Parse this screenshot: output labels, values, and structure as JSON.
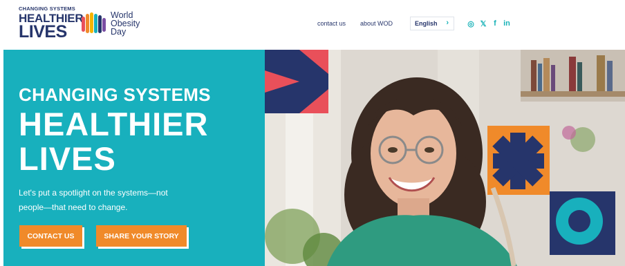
{
  "header": {
    "campaign_logo": {
      "line1": "CHANGING SYSTEMS",
      "line2": "HEALTHIER",
      "line3": "LIVES"
    },
    "wod_logo": {
      "line1": "World",
      "line2": "Obesity",
      "line3": "Day"
    },
    "nav": {
      "contact": "contact us",
      "about": "about WOD"
    },
    "language": {
      "selected": "English",
      "chevron": "›"
    },
    "social": [
      {
        "name": "instagram-icon",
        "glyph": "◎"
      },
      {
        "name": "x-icon",
        "glyph": "𝕏"
      },
      {
        "name": "facebook-icon",
        "glyph": "f"
      },
      {
        "name": "linkedin-icon",
        "glyph": "in"
      }
    ]
  },
  "hero": {
    "title_line1": "CHANGING SYSTEMS",
    "title_line2": "HEALTHIER",
    "title_line3": "LIVES",
    "subtitle_line1": "Let's put a spotlight on the systems—not",
    "subtitle_line2": "people—that need to change.",
    "buttons": {
      "contact": "CONTACT US",
      "share": "SHARE YOUR STORY"
    }
  },
  "colors": {
    "navy": "#26356b",
    "teal": "#18b0bd",
    "orange": "#f08a2a",
    "coral": "#e9505a"
  }
}
